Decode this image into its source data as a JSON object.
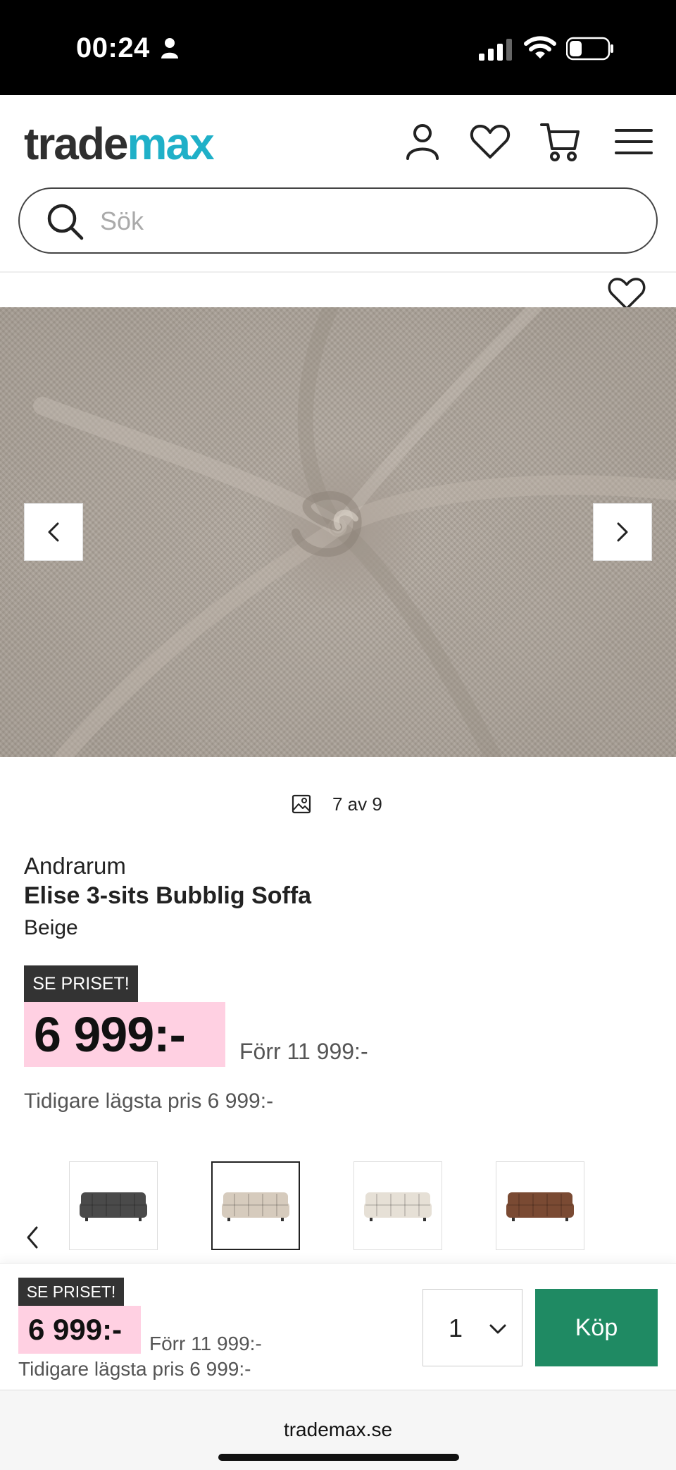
{
  "status_bar": {
    "time": "00:24"
  },
  "header": {
    "logo_part1": "trade",
    "logo_part2": "max",
    "icons": [
      "account-icon",
      "wishlist-icon",
      "cart-icon",
      "menu-icon"
    ]
  },
  "search": {
    "placeholder": "Sök",
    "value": ""
  },
  "gallery": {
    "counter": "7 av 9",
    "current": 7,
    "total": 9
  },
  "product": {
    "brand": "Andrarum",
    "name": "Elise 3-sits Bubblig Soffa",
    "color": "Beige",
    "badge": "SE PRISET!",
    "price": "6 999:-",
    "was_price": "Förr 11 999:-",
    "lowest_price": "Tidigare lägsta pris 6 999:-"
  },
  "variants": [
    {
      "name": "dark-grey",
      "color": "#4a4a4a",
      "selected": false
    },
    {
      "name": "beige",
      "color": "#d6cbbd",
      "selected": true
    },
    {
      "name": "cream",
      "color": "#e6e0d6",
      "selected": false
    },
    {
      "name": "brown",
      "color": "#7a4a33",
      "selected": false
    }
  ],
  "buy_bar": {
    "badge": "SE PRISET!",
    "price": "6 999:-",
    "was_price": "Förr 11 999:-",
    "lowest_price": "Tidigare lägsta pris 6 999:-",
    "quantity": "1",
    "buy_label": "Köp"
  },
  "browser": {
    "url": "trademax.se"
  },
  "colors": {
    "accent": "#1fb0c8",
    "buy": "#1f8a63",
    "price_highlight": "#ffd0e2",
    "badge": "#333333"
  }
}
